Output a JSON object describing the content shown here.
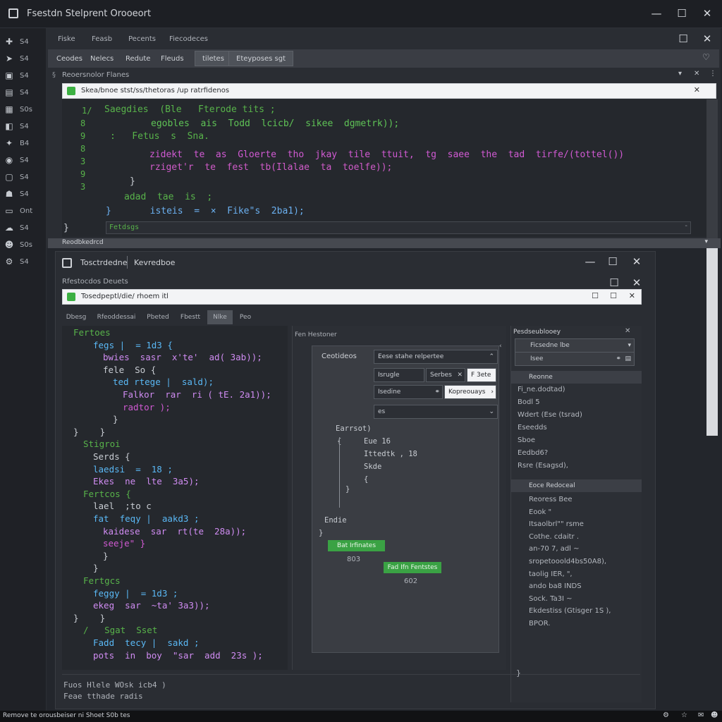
{
  "app": {
    "title": "Fsestdn Stelprent Orooeort"
  },
  "sidebar": {
    "items": [
      {
        "icon": "puzzle-icon",
        "glyph": "✚",
        "label": "S4"
      },
      {
        "icon": "pin-icon",
        "glyph": "➤",
        "label": "S4"
      },
      {
        "icon": "book-icon",
        "glyph": "▣",
        "label": "S4"
      },
      {
        "icon": "layers-icon",
        "glyph": "▤",
        "label": "S4"
      },
      {
        "icon": "monitor-icon",
        "glyph": "▦",
        "label": "S0s"
      },
      {
        "icon": "git-icon",
        "glyph": "◧",
        "label": "S4"
      },
      {
        "icon": "bird-icon",
        "glyph": "✦",
        "label": "B4"
      },
      {
        "icon": "globe-icon",
        "glyph": "◉",
        "label": "S4"
      },
      {
        "icon": "window-icon",
        "glyph": "▢",
        "label": "S4"
      },
      {
        "icon": "users-icon",
        "glyph": "☗",
        "label": "S4"
      },
      {
        "icon": "display-icon",
        "glyph": "▭",
        "label": "Ont"
      },
      {
        "icon": "cloud-icon",
        "glyph": "☁",
        "label": "S4"
      },
      {
        "icon": "person-icon",
        "glyph": "☻",
        "label": "S0s"
      },
      {
        "icon": "gear-icon",
        "glyph": "⚙",
        "label": "S4"
      }
    ]
  },
  "window1": {
    "menu": [
      "Fiske",
      "Feasb",
      "Pecents",
      "Fiecodeces"
    ],
    "toolbar": [
      "Ceodes",
      "Nelecs",
      "Redute",
      "Fleuds",
      "tiletes",
      "Eteyposes sgt"
    ],
    "toolbar_active": [
      4,
      5
    ],
    "section_label": "Reoersnolor Flanes",
    "address": "Skea/bnoe stst/ss/thetoras /up ratrfidenos",
    "line_numbers": [
      "1/",
      "8",
      "9",
      "8",
      "3",
      "9",
      "3"
    ],
    "code": [
      {
        "text": "Saegdies  (Ble   Fterode tits ;",
        "color": "#58b34a"
      },
      {
        "text": "egobles  ais  Todd  lcicb/  sikee  dgmetrk));",
        "color": "#5fc356"
      },
      {
        "text": ":   Fetus  s  Sna.",
        "color": "#58b34a"
      },
      {
        "text": "zidekt  te  as  Gloerte  tho  jkay  tile  ttuit,  tg  saee  the  tad  tirfe/(tottel())",
        "color": "#d15ad3"
      },
      {
        "text": "rziget'r  te  fest  tb(Ilalae  ta  toelfe));",
        "color": "#cf5bc8"
      },
      {
        "text": "}",
        "color": "#c8ccd2"
      },
      {
        "text": "adad  tae  is  ;",
        "color": "#58b34a"
      },
      {
        "text": "}       isteis  =  ×  Fike\"s  2ba1);",
        "color": "#6bb0f0"
      },
      {
        "text": "}",
        "color": "#c8ccd2"
      }
    ],
    "find_text": "Fetdsgs",
    "status": "Reodbkedrcd"
  },
  "window2": {
    "title": "Tosctrdedne",
    "title2": "Kevredboe",
    "sub_label": "Rfestocdos  Deuets",
    "address": "Tosedpeptl/die/ rhoem itl",
    "tabs": [
      "Dbesg",
      "Rfeoddessai",
      "Pbeted",
      "Fbestt",
      "Nlke",
      "Peo"
    ],
    "active_tab": 4,
    "code": [
      {
        "text": "Fertoes",
        "color": "#58b34a",
        "indent": 0
      },
      {
        "text": "fegs |  = 1d3 {",
        "color": "#5ab8f5",
        "indent": 2
      },
      {
        "text": "bwies  sasr  x'te'  ad( 3ab));",
        "color": "#d08cf2",
        "indent": 3
      },
      {
        "text": "fele  So {",
        "color": "#c8ccd2",
        "indent": 3
      },
      {
        "text": "ted rtege |  sald);",
        "color": "#5ab8f5",
        "indent": 4
      },
      {
        "text": "Falkor  rar  ri ( tE. 2a1));",
        "color": "#d08cf2",
        "indent": 5
      },
      {
        "text": "radtor );",
        "color": "#d15ad3",
        "indent": 5
      },
      {
        "text": "}",
        "color": "#c8ccd2",
        "indent": 4
      },
      {
        "text": "}    }",
        "color": "#c8ccd2",
        "indent": 0
      },
      {
        "text": "Stigroi",
        "color": "#58b34a",
        "indent": 1
      },
      {
        "text": "Serds {",
        "color": "#c8ccd2",
        "indent": 2
      },
      {
        "text": "laedsi  =  18 ;",
        "color": "#5ab8f5",
        "indent": 2
      },
      {
        "text": "Ekes  ne  lte  3a5);",
        "color": "#d08cf2",
        "indent": 2
      },
      {
        "text": "Fertcos {",
        "color": "#58b34a",
        "indent": 1
      },
      {
        "text": "lael  ;to c",
        "color": "#c8ccd2",
        "indent": 2
      },
      {
        "text": "fat  feqy |  aakd3 ;",
        "color": "#5ab8f5",
        "indent": 2
      },
      {
        "text": "kaidese  sar  rt(te  28a));",
        "color": "#d08cf2",
        "indent": 3
      },
      {
        "text": "seeje\" }",
        "color": "#d15ad3",
        "indent": 3
      },
      {
        "text": "}",
        "color": "#c8ccd2",
        "indent": 3
      },
      {
        "text": "}",
        "color": "#c8ccd2",
        "indent": 2
      },
      {
        "text": "Fertgcs",
        "color": "#58b34a",
        "indent": 1
      },
      {
        "text": "feggy |  = 1d3 ;",
        "color": "#5ab8f5",
        "indent": 2
      },
      {
        "text": "ekeg  sar  ~ta' 3a3));",
        "color": "#d08cf2",
        "indent": 2
      },
      {
        "text": "}    }",
        "color": "#c8ccd2",
        "indent": 0
      },
      {
        "text": "/   Sgat  Sset",
        "color": "#58b34a",
        "indent": 1
      },
      {
        "text": "Fadd  tecy |  sakd ;",
        "color": "#5ab8f5",
        "indent": 2
      },
      {
        "text": "pots  in  boy  \"sar  add  23s );",
        "color": "#d08cf2",
        "indent": 2
      }
    ],
    "mid_header": "Fen Hestoner",
    "form": {
      "label": "Ceotideos",
      "select1": "Eese stahe relpertee",
      "row2_a": "Isrugle",
      "row2_b": "Serbes",
      "row2_c": "F 3ete",
      "row3_a": "Isedine",
      "row3_b": "Kopreouays",
      "select3": "es",
      "snippet": [
        "Earrsot)",
        "{",
        "Eue 16",
        "Ittedtk  , 18",
        "Skde",
        "{",
        "}",
        "Endie",
        "}"
      ],
      "btn1": "Bat Irfinates",
      "btn1_val": "803",
      "btn2": "Fad Ifn Fentstes",
      "btn2_val": "602"
    },
    "right_panel": {
      "title": "Pesdseublooey",
      "dropdown1": "Ficsedne lbe",
      "field2": "Isee",
      "section1": "Reonne",
      "section1_items": [
        "Fi_ne.dodtad)",
        "Bodl 5",
        "Wdert (Ese (tsrad)",
        "Eseedds",
        "Sboe",
        "Eedbd6?",
        "Rsre  (Esagsd),"
      ],
      "section2": "Eoce Redoceal",
      "section2_items": [
        "Reoress Bee",
        "Eook  \"",
        "Itsaolbrl\"\" rsme",
        "Cothe. cdaitr .",
        "an-70 7, adl ~",
        "sropetooold4bs50A8),",
        "taolig IER,  \",",
        "ando  ba8  INDS",
        "Sock. Ta3I ~",
        "Ekdestiss  (Gtisger  1S ),",
        "BPOR."
      ]
    },
    "bottom_lines": [
      "Fuos  Hlele  WOsk  icb4 )",
      "Feae  tthade  radis"
    ]
  },
  "status_bar": "Remove te orousbeiser ni Shoet S0b tes"
}
